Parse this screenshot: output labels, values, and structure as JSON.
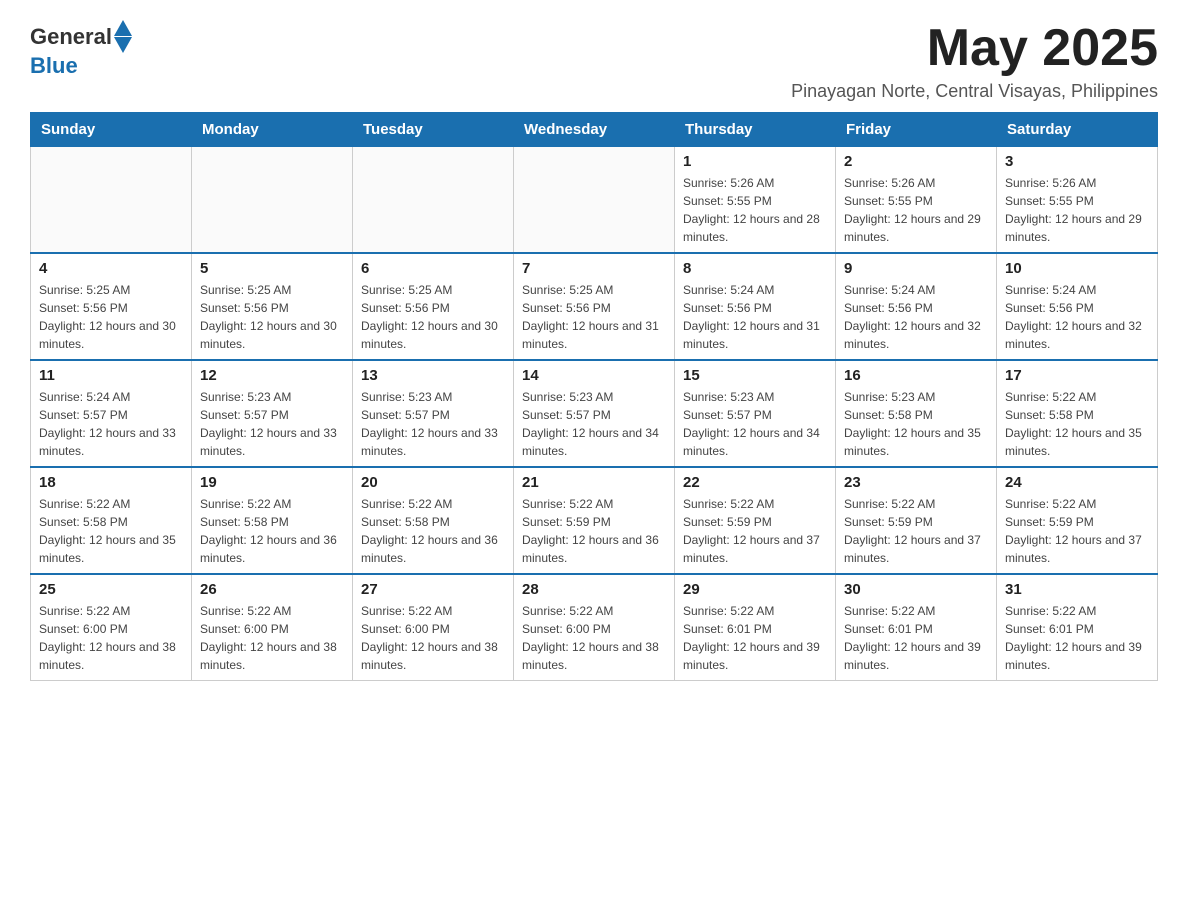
{
  "header": {
    "logo_general": "General",
    "logo_blue": "Blue",
    "month_year": "May 2025",
    "location": "Pinayagan Norte, Central Visayas, Philippines"
  },
  "days_of_week": [
    "Sunday",
    "Monday",
    "Tuesday",
    "Wednesday",
    "Thursday",
    "Friday",
    "Saturday"
  ],
  "weeks": [
    [
      {
        "day": "",
        "info": ""
      },
      {
        "day": "",
        "info": ""
      },
      {
        "day": "",
        "info": ""
      },
      {
        "day": "",
        "info": ""
      },
      {
        "day": "1",
        "info": "Sunrise: 5:26 AM\nSunset: 5:55 PM\nDaylight: 12 hours and 28 minutes."
      },
      {
        "day": "2",
        "info": "Sunrise: 5:26 AM\nSunset: 5:55 PM\nDaylight: 12 hours and 29 minutes."
      },
      {
        "day": "3",
        "info": "Sunrise: 5:26 AM\nSunset: 5:55 PM\nDaylight: 12 hours and 29 minutes."
      }
    ],
    [
      {
        "day": "4",
        "info": "Sunrise: 5:25 AM\nSunset: 5:56 PM\nDaylight: 12 hours and 30 minutes."
      },
      {
        "day": "5",
        "info": "Sunrise: 5:25 AM\nSunset: 5:56 PM\nDaylight: 12 hours and 30 minutes."
      },
      {
        "day": "6",
        "info": "Sunrise: 5:25 AM\nSunset: 5:56 PM\nDaylight: 12 hours and 30 minutes."
      },
      {
        "day": "7",
        "info": "Sunrise: 5:25 AM\nSunset: 5:56 PM\nDaylight: 12 hours and 31 minutes."
      },
      {
        "day": "8",
        "info": "Sunrise: 5:24 AM\nSunset: 5:56 PM\nDaylight: 12 hours and 31 minutes."
      },
      {
        "day": "9",
        "info": "Sunrise: 5:24 AM\nSunset: 5:56 PM\nDaylight: 12 hours and 32 minutes."
      },
      {
        "day": "10",
        "info": "Sunrise: 5:24 AM\nSunset: 5:56 PM\nDaylight: 12 hours and 32 minutes."
      }
    ],
    [
      {
        "day": "11",
        "info": "Sunrise: 5:24 AM\nSunset: 5:57 PM\nDaylight: 12 hours and 33 minutes."
      },
      {
        "day": "12",
        "info": "Sunrise: 5:23 AM\nSunset: 5:57 PM\nDaylight: 12 hours and 33 minutes."
      },
      {
        "day": "13",
        "info": "Sunrise: 5:23 AM\nSunset: 5:57 PM\nDaylight: 12 hours and 33 minutes."
      },
      {
        "day": "14",
        "info": "Sunrise: 5:23 AM\nSunset: 5:57 PM\nDaylight: 12 hours and 34 minutes."
      },
      {
        "day": "15",
        "info": "Sunrise: 5:23 AM\nSunset: 5:57 PM\nDaylight: 12 hours and 34 minutes."
      },
      {
        "day": "16",
        "info": "Sunrise: 5:23 AM\nSunset: 5:58 PM\nDaylight: 12 hours and 35 minutes."
      },
      {
        "day": "17",
        "info": "Sunrise: 5:22 AM\nSunset: 5:58 PM\nDaylight: 12 hours and 35 minutes."
      }
    ],
    [
      {
        "day": "18",
        "info": "Sunrise: 5:22 AM\nSunset: 5:58 PM\nDaylight: 12 hours and 35 minutes."
      },
      {
        "day": "19",
        "info": "Sunrise: 5:22 AM\nSunset: 5:58 PM\nDaylight: 12 hours and 36 minutes."
      },
      {
        "day": "20",
        "info": "Sunrise: 5:22 AM\nSunset: 5:58 PM\nDaylight: 12 hours and 36 minutes."
      },
      {
        "day": "21",
        "info": "Sunrise: 5:22 AM\nSunset: 5:59 PM\nDaylight: 12 hours and 36 minutes."
      },
      {
        "day": "22",
        "info": "Sunrise: 5:22 AM\nSunset: 5:59 PM\nDaylight: 12 hours and 37 minutes."
      },
      {
        "day": "23",
        "info": "Sunrise: 5:22 AM\nSunset: 5:59 PM\nDaylight: 12 hours and 37 minutes."
      },
      {
        "day": "24",
        "info": "Sunrise: 5:22 AM\nSunset: 5:59 PM\nDaylight: 12 hours and 37 minutes."
      }
    ],
    [
      {
        "day": "25",
        "info": "Sunrise: 5:22 AM\nSunset: 6:00 PM\nDaylight: 12 hours and 38 minutes."
      },
      {
        "day": "26",
        "info": "Sunrise: 5:22 AM\nSunset: 6:00 PM\nDaylight: 12 hours and 38 minutes."
      },
      {
        "day": "27",
        "info": "Sunrise: 5:22 AM\nSunset: 6:00 PM\nDaylight: 12 hours and 38 minutes."
      },
      {
        "day": "28",
        "info": "Sunrise: 5:22 AM\nSunset: 6:00 PM\nDaylight: 12 hours and 38 minutes."
      },
      {
        "day": "29",
        "info": "Sunrise: 5:22 AM\nSunset: 6:01 PM\nDaylight: 12 hours and 39 minutes."
      },
      {
        "day": "30",
        "info": "Sunrise: 5:22 AM\nSunset: 6:01 PM\nDaylight: 12 hours and 39 minutes."
      },
      {
        "day": "31",
        "info": "Sunrise: 5:22 AM\nSunset: 6:01 PM\nDaylight: 12 hours and 39 minutes."
      }
    ]
  ]
}
